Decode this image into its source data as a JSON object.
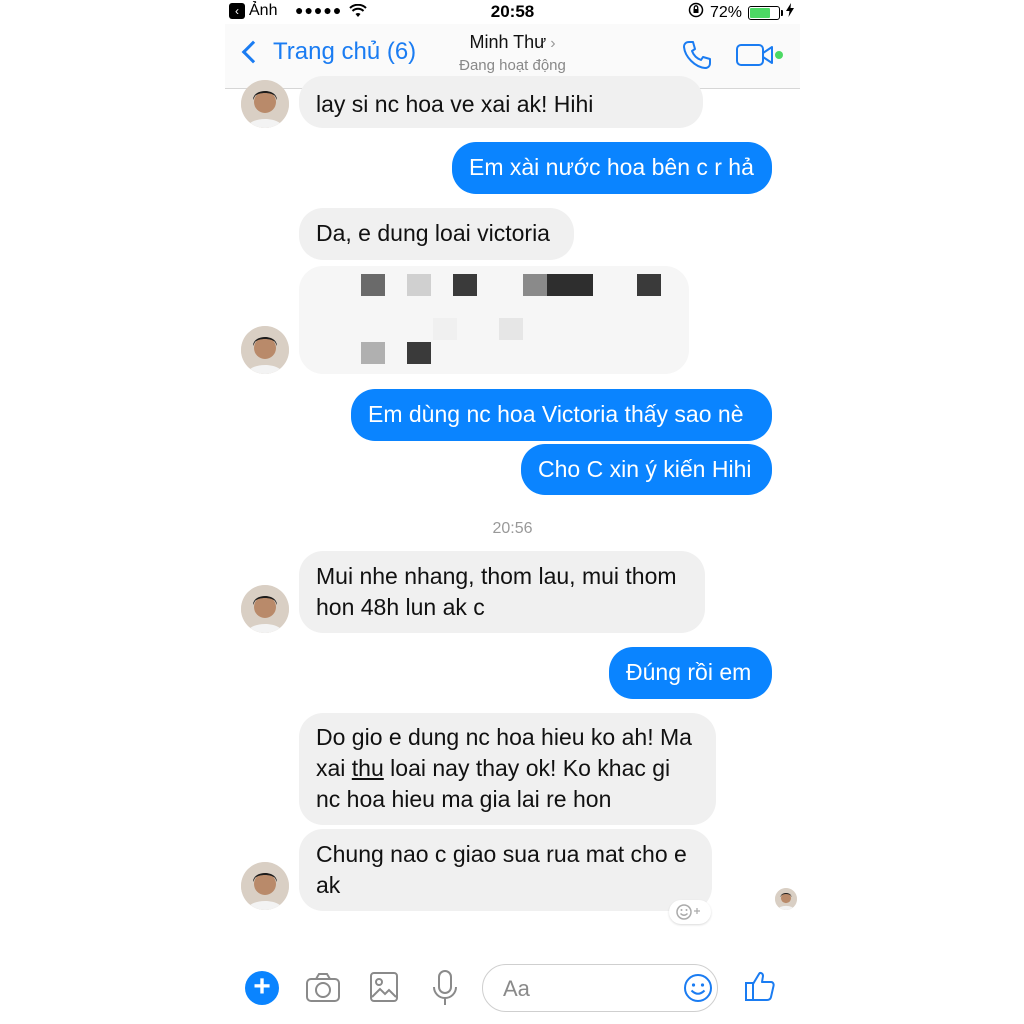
{
  "status_bar": {
    "back_app": "Ảnh",
    "signal": "●●●●●",
    "time": "20:58",
    "battery_percent": "72%",
    "battery_level": 0.72
  },
  "header": {
    "back_label": "Trang chủ (6)",
    "contact_name": "Minh Thư",
    "contact_status": "Đang hoạt động"
  },
  "messages": [
    {
      "side": "in",
      "text": "lay si nc hoa ve xai ak! Hihi"
    },
    {
      "side": "out",
      "text": "Em xài nước hoa bên c r hả"
    },
    {
      "side": "in",
      "text": "Da, e dung loai victoria"
    },
    {
      "side": "out",
      "text": "Em dùng nc hoa Victoria thấy sao nè"
    },
    {
      "side": "out",
      "text": "Cho C xin ý kiến Hihi"
    },
    {
      "side": "in",
      "text": "Mui nhe nhang, thom lau, mui thom hon 48h lun ak c"
    },
    {
      "side": "out",
      "text": "Đúng rồi em"
    },
    {
      "side": "in",
      "text_a": "Do gio e dung nc hoa hieu ko ah! Ma xai ",
      "text_u": "thu",
      "text_b": " loai nay thay ok! Ko khac gi nc hoa hieu ma gia lai re hon"
    },
    {
      "side": "in",
      "text": "Chung nao c giao sua rua mat cho e ak"
    }
  ],
  "timestamp": "20:56",
  "composer": {
    "placeholder": "Aa"
  },
  "colors": {
    "accent": "#0a84ff",
    "incoming_bubble": "#f0f0f0",
    "online_dot": "#4cd964"
  },
  "icons": [
    "plus-icon",
    "camera-icon",
    "image-icon",
    "microphone-icon",
    "emoji-icon",
    "thumbs-up-icon",
    "phone-icon",
    "video-icon"
  ]
}
